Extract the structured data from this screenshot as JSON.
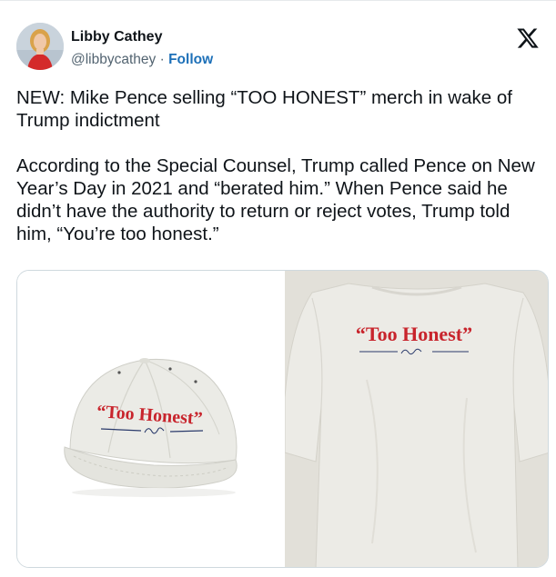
{
  "author": {
    "name": "Libby Cathey",
    "handle": "@libbycathey",
    "separator": "·",
    "follow_label": "Follow"
  },
  "platform_icon": "x-logo-icon",
  "tweet": {
    "paragraph1": "NEW: Mike Pence selling “TOO HONEST” merch in wake of Trump indictment",
    "paragraph2": "According to the Special Counsel, Trump called Pence on New Year’s Day in 2021 and “berated him.” When Pence said he didn’t have the authority to return or reject votes, Trump told him, “You’re too honest.”"
  },
  "media": {
    "cap_text": "“Too Honest”",
    "shirt_text": "“Too Honest”"
  },
  "colors": {
    "text": "#0f1419",
    "secondary": "#536471",
    "link": "#1d70b8",
    "merch_red": "#c8242c",
    "merch_navy": "#2a3a6b"
  }
}
